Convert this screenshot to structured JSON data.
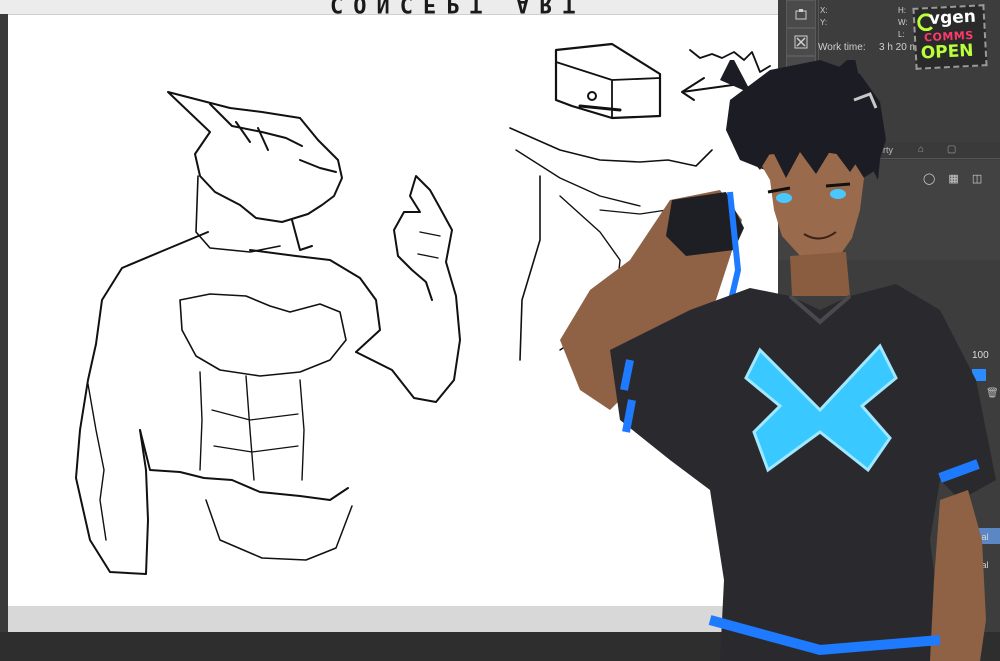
{
  "canvas": {
    "title": "CONCEPT ART"
  },
  "navigator": {
    "buttons": [
      "camera-icon",
      "close-icon",
      "layers-icon"
    ],
    "x_label": "X:",
    "y_label": "Y:",
    "h_label": "H:",
    "w_label": "W:",
    "l_label": "L:",
    "work_time_label": "Work time:",
    "work_time_value": "3 h 20 m"
  },
  "properties": {
    "tab_label": "perty"
  },
  "layers": {
    "opacity": "100",
    "blend_1": "mal",
    "blend_2": "mal"
  },
  "badge": {
    "brand": "vgen",
    "line1": "COMMS",
    "line2": "OPEN"
  },
  "colors": {
    "accent": "#2a8cff",
    "glow": "#39c8ff",
    "badge_green": "#b9ff3b",
    "badge_pink": "#ff3a6a"
  }
}
